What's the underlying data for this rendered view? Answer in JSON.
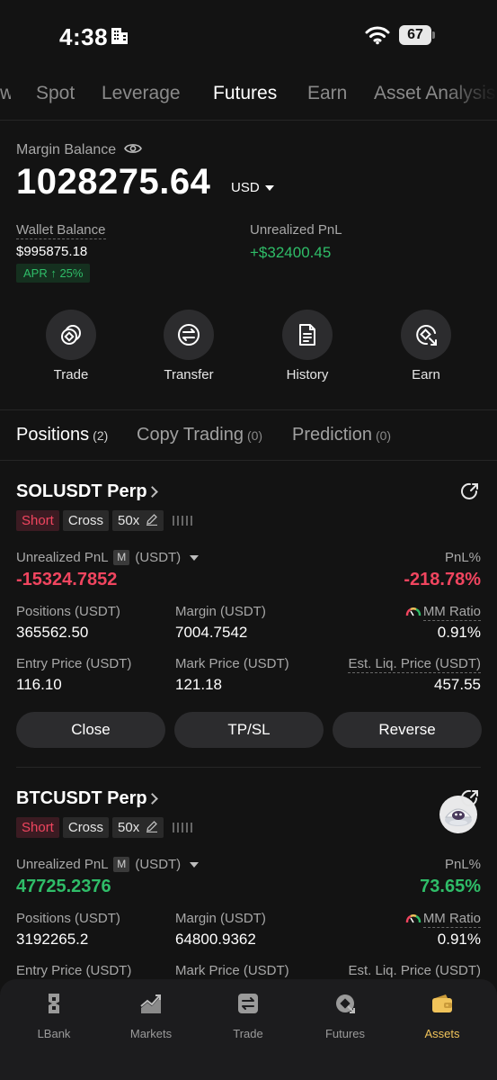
{
  "status_bar": {
    "time": "4:38",
    "battery": "67"
  },
  "top_tabs": {
    "items": [
      "Spot",
      "Leverage",
      "Futures",
      "Earn",
      "Asset Analysis"
    ],
    "active": "Futures"
  },
  "balance": {
    "margin_label": "Margin Balance",
    "amount": "1028275.64",
    "currency": "USD",
    "wallet_label": "Wallet Balance",
    "wallet_value": "$995875.18",
    "apr": "APR ↑ 25%",
    "unrealized_label": "Unrealized PnL",
    "unrealized_value": "+$32400.45"
  },
  "actions": [
    {
      "label": "Trade",
      "icon": "trade-icon"
    },
    {
      "label": "Transfer",
      "icon": "transfer-icon"
    },
    {
      "label": "History",
      "icon": "history-icon"
    },
    {
      "label": "Earn",
      "icon": "earn-icon"
    }
  ],
  "section_tabs": [
    {
      "label": "Positions",
      "count": "(2)"
    },
    {
      "label": "Copy Trading",
      "count": "(0)"
    },
    {
      "label": "Prediction",
      "count": "(0)"
    }
  ],
  "positions": [
    {
      "symbol": "SOLUSDT Perp",
      "side": "Short",
      "margin_mode": "Cross",
      "leverage": "50x",
      "unrealized_label": "Unrealized PnL",
      "unrealized_badge": "M",
      "unrealized_unit": "(USDT)",
      "unrealized_value": "-15324.7852",
      "pnl_pct_label": "PnL%",
      "pnl_pct": "-218.78%",
      "positions_label": "Positions (USDT)",
      "positions_value": "365562.50",
      "margin_label": "Margin (USDT)",
      "margin_value": "7004.7542",
      "mm_label": "MM Ratio",
      "mm_value": "0.91%",
      "entry_label": "Entry Price (USDT)",
      "entry_value": "116.10",
      "mark_label": "Mark Price (USDT)",
      "mark_value": "121.18",
      "liq_label": "Est. Liq. Price (USDT)",
      "liq_value": "457.55",
      "buttons": [
        "Close",
        "TP/SL",
        "Reverse"
      ]
    },
    {
      "symbol": "BTCUSDT Perp",
      "side": "Short",
      "margin_mode": "Cross",
      "leverage": "50x",
      "unrealized_label": "Unrealized PnL",
      "unrealized_badge": "M",
      "unrealized_unit": "(USDT)",
      "unrealized_value": "47725.2376",
      "pnl_pct_label": "PnL%",
      "pnl_pct": "73.65%",
      "positions_label": "Positions (USDT)",
      "positions_value": "3192265.2",
      "margin_label": "Margin (USDT)",
      "margin_value": "64800.9362",
      "mm_label": "MM Ratio",
      "mm_value": "0.91%",
      "entry_label": "Entry Price (USDT)",
      "mark_label": "Mark Price (USDT)",
      "liq_label": "Est. Liq. Price (USDT)"
    }
  ],
  "bottom_nav": [
    {
      "label": "LBank",
      "icon": "lbank-icon"
    },
    {
      "label": "Markets",
      "icon": "markets-icon"
    },
    {
      "label": "Trade",
      "icon": "trade-nav-icon"
    },
    {
      "label": "Futures",
      "icon": "futures-icon"
    },
    {
      "label": "Assets",
      "icon": "assets-wallet-icon"
    }
  ],
  "colors": {
    "profit": "#2fbd68",
    "loss": "#f0455f",
    "accent": "#f0c35a",
    "background": "#131313"
  }
}
